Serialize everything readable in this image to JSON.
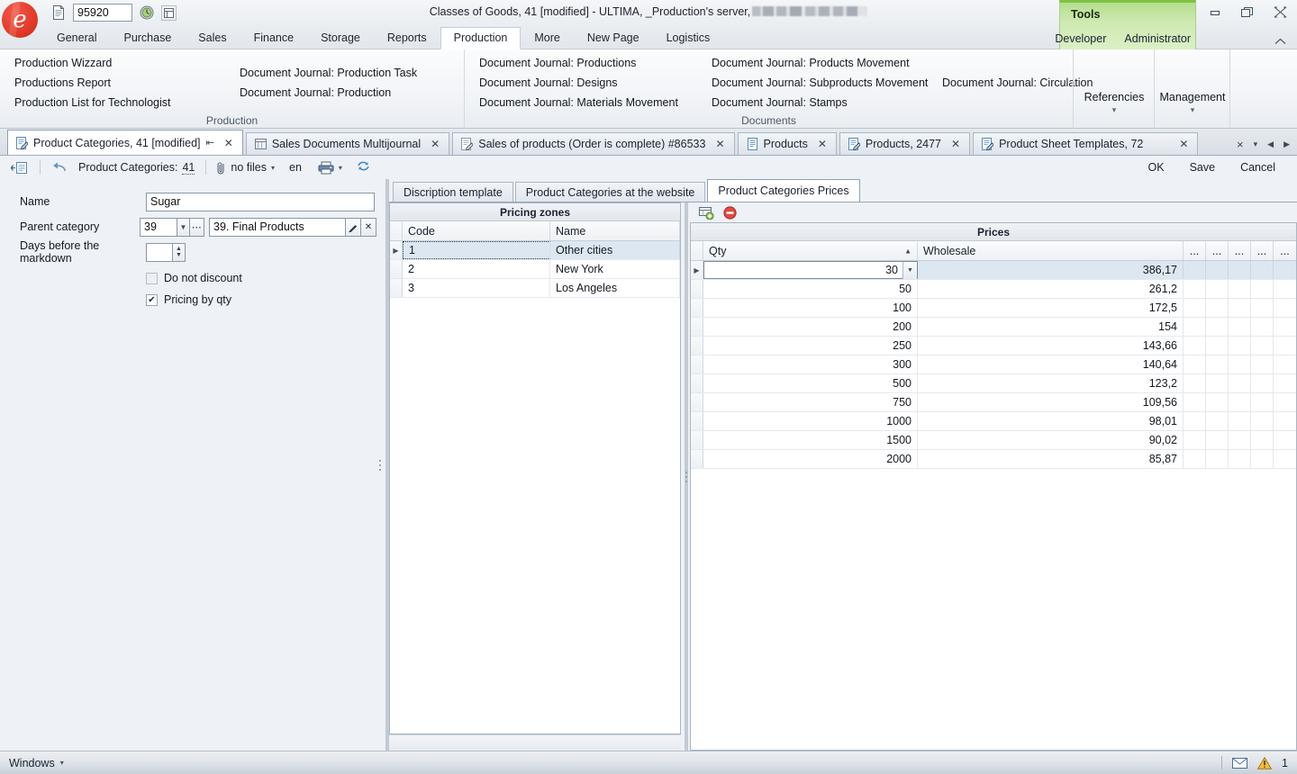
{
  "window": {
    "title": "Classes of Goods, 41 [modified] - ULTIMA, _Production's server,",
    "quick_access": {
      "doc_icon": "document-icon",
      "code_value": "95920",
      "clock_icon": "clock-icon",
      "panel_icon": "panel-icon"
    },
    "buttons": {
      "minimize": "minimize-icon",
      "restore": "restore-icon",
      "close": "close-icon"
    }
  },
  "ribbon": {
    "menu": [
      {
        "label": "General",
        "active": false
      },
      {
        "label": "Purchase",
        "active": false
      },
      {
        "label": "Sales",
        "active": false
      },
      {
        "label": "Finance",
        "active": false
      },
      {
        "label": "Storage",
        "active": false
      },
      {
        "label": "Reports",
        "active": false
      },
      {
        "label": "Production",
        "active": true
      },
      {
        "label": "More",
        "active": false
      },
      {
        "label": "New Page",
        "active": false
      },
      {
        "label": "Logistics",
        "active": false
      }
    ],
    "tools": {
      "title": "Tools",
      "sub": [
        "Developer",
        "Administrator"
      ],
      "accent": "#7cc242"
    },
    "collapse_icon": "collapse-ribbon-icon",
    "groups": [
      {
        "title": "Production",
        "columns": [
          [
            "Production Wizzard",
            "Productions Report",
            "Production List for Technologist"
          ],
          [
            "Document Journal: Production Task",
            "Document Journal: Production"
          ]
        ]
      },
      {
        "title": "Documents",
        "columns": [
          [
            "Document Journal: Productions",
            "Document Journal: Designs",
            "Document Journal: Materials Movement"
          ],
          [
            "Document Journal: Products Movement",
            "Document Journal: Subproducts Movement",
            "Document Journal: Stamps"
          ],
          [
            "Document Journal: Circulation"
          ]
        ]
      }
    ],
    "big_buttons": [
      {
        "label": "Referencies",
        "caret": "▾"
      },
      {
        "label": "Management",
        "caret": "▾"
      }
    ]
  },
  "doc_tabs": {
    "items": [
      {
        "label": "Product Categories, 41 [modified]",
        "icon": "edit-document-icon",
        "active": true,
        "pinned": true,
        "closable": true
      },
      {
        "label": "Sales Documents Multijournal",
        "icon": "journal-icon",
        "active": false,
        "pinned": false,
        "closable": true
      },
      {
        "label": "Sales of products (Order is complete) #86533",
        "icon": "edit-document-icon",
        "active": false,
        "pinned": false,
        "closable": true
      },
      {
        "label": "Products",
        "icon": "list-icon",
        "active": false,
        "pinned": false,
        "closable": true
      },
      {
        "label": "Products, 2477",
        "icon": "edit-document-icon",
        "active": false,
        "pinned": false,
        "closable": true
      },
      {
        "label": "Product Sheet Templates, 72",
        "icon": "edit-document-icon",
        "active": false,
        "pinned": false,
        "closable": true
      }
    ],
    "nav": {
      "close_all": "×",
      "list": "▾",
      "prev": "◀",
      "next": "▶"
    }
  },
  "form_toolbar": {
    "new_icon": "new-record-icon",
    "back_icon": "back-arrow-icon",
    "entity_label": "Product Categories:",
    "entity_id": "41",
    "attach_icon": "paperclip-icon",
    "files_label": "no files",
    "files_caret": "▾",
    "lang": "en",
    "print_icon": "printer-icon",
    "print_caret": "▾",
    "refresh_icon": "refresh-icon",
    "actions": [
      "OK",
      "Save",
      "Cancel"
    ]
  },
  "form": {
    "fields": [
      {
        "label": "Name",
        "value": "Sugar",
        "name": "name-field"
      },
      {
        "label": "Parent category",
        "code": "39",
        "value": "39. Final Products",
        "name": "parent-category-field"
      },
      {
        "label": "Days before the markdown",
        "value": "",
        "name": "days-before-markdown-field"
      }
    ],
    "checkboxes": [
      {
        "label": "Do not discount",
        "checked": false
      },
      {
        "label": "Pricing by qty",
        "checked": true
      }
    ]
  },
  "inner_tabs": [
    {
      "label": "Discription template",
      "active": false
    },
    {
      "label": "Product Categories at the website",
      "active": false
    },
    {
      "label": "Product Categories Prices",
      "active": true
    }
  ],
  "pricing_zones": {
    "title": "Pricing zones",
    "columns": [
      "Code",
      "Name"
    ],
    "rows": [
      {
        "code": "1",
        "name": "Other cities",
        "selected": true
      },
      {
        "code": "2",
        "name": "New York",
        "selected": false
      },
      {
        "code": "3",
        "name": "Los Angeles",
        "selected": false
      }
    ]
  },
  "prices": {
    "toolbar": {
      "add_icon": "add-row-icon",
      "delete_icon": "delete-row-icon"
    },
    "title": "Prices",
    "columns": [
      "Qty",
      "Wholesale",
      "...",
      "...",
      "...",
      "...",
      "..."
    ],
    "sort": {
      "column": "Qty",
      "direction": "asc",
      "glyph": "▲"
    },
    "rows": [
      {
        "qty": "30",
        "wholesale": "386,17",
        "selected": true,
        "editing": true
      },
      {
        "qty": "50",
        "wholesale": "261,2",
        "selected": false,
        "editing": false
      },
      {
        "qty": "100",
        "wholesale": "172,5",
        "selected": false,
        "editing": false
      },
      {
        "qty": "200",
        "wholesale": "154",
        "selected": false,
        "editing": false
      },
      {
        "qty": "250",
        "wholesale": "143,66",
        "selected": false,
        "editing": false
      },
      {
        "qty": "300",
        "wholesale": "140,64",
        "selected": false,
        "editing": false
      },
      {
        "qty": "500",
        "wholesale": "123,2",
        "selected": false,
        "editing": false
      },
      {
        "qty": "750",
        "wholesale": "109,56",
        "selected": false,
        "editing": false
      },
      {
        "qty": "1000",
        "wholesale": "98,01",
        "selected": false,
        "editing": false
      },
      {
        "qty": "1500",
        "wholesale": "90,02",
        "selected": false,
        "editing": false
      },
      {
        "qty": "2000",
        "wholesale": "85,87",
        "selected": false,
        "editing": false
      }
    ]
  },
  "status_bar": {
    "windows_label": "Windows",
    "windows_caret": "▾",
    "mail_icon": "envelope-icon",
    "warning_icon": "warning-icon",
    "warning_count": "1"
  }
}
